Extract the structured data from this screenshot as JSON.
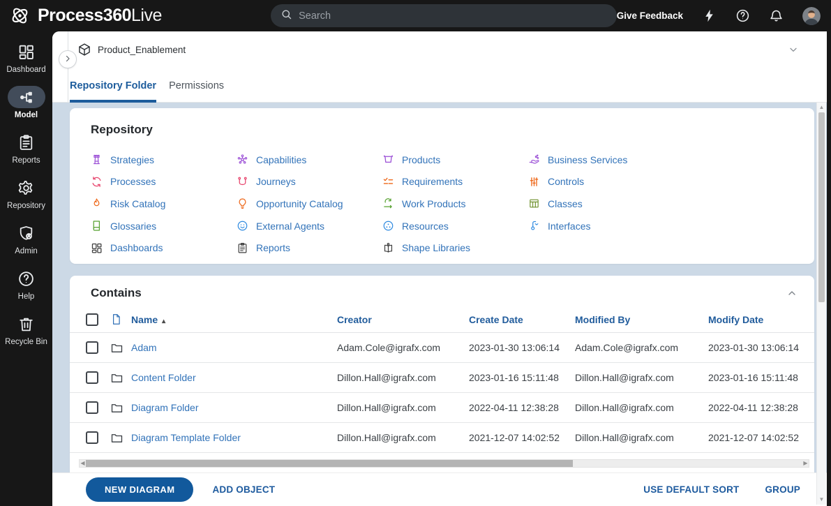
{
  "topbar": {
    "logo": {
      "bold": "Process360",
      "light": "Live",
      "icon": "logo"
    },
    "search": {
      "placeholder": "Search",
      "icon": "search"
    },
    "give_feedback": "Give Feedback",
    "actions": [
      {
        "icon": "lightning"
      },
      {
        "icon": "help-circle"
      },
      {
        "icon": "bell"
      }
    ],
    "avatar_icon": "avatar"
  },
  "sidebar": {
    "items": [
      {
        "label": "Dashboard",
        "icon": "dashboard",
        "active": false
      },
      {
        "label": "Model",
        "icon": "model",
        "active": true
      },
      {
        "label": "Reports",
        "icon": "reports",
        "active": false
      },
      {
        "label": "Repository",
        "icon": "repository",
        "active": false
      },
      {
        "label": "Admin",
        "icon": "admin",
        "active": false
      },
      {
        "label": "Help",
        "icon": "help",
        "active": false
      },
      {
        "label": "Recycle Bin",
        "icon": "recycle-bin",
        "active": false
      }
    ]
  },
  "page": {
    "title": "Product_Enablement",
    "title_icon": "cube",
    "tabs": [
      {
        "label": "Repository Folder",
        "active": true
      },
      {
        "label": "Permissions",
        "active": false
      }
    ]
  },
  "repository_panel": {
    "title": "Repository",
    "columns": [
      [
        {
          "label": "Strategies",
          "icon": "strategies",
          "color": "#9b4fd6"
        },
        {
          "label": "Processes",
          "icon": "processes",
          "color": "#e8476f"
        },
        {
          "label": "Risk Catalog",
          "icon": "risk-catalog",
          "color": "#ee6718"
        },
        {
          "label": "Glossaries",
          "icon": "glossaries",
          "color": "#55a02e"
        },
        {
          "label": "Dashboards",
          "icon": "dashboards",
          "color": "#3d3d3d"
        }
      ],
      [
        {
          "label": "Capabilities",
          "icon": "capabilities",
          "color": "#9b4fd6"
        },
        {
          "label": "Journeys",
          "icon": "journeys",
          "color": "#e8476f"
        },
        {
          "label": "Opportunity Catalog",
          "icon": "opportunity-catalog",
          "color": "#ee6718"
        },
        {
          "label": "External Agents",
          "icon": "external-agents",
          "color": "#2e8ae0"
        },
        {
          "label": "Reports",
          "icon": "reports",
          "color": "#3d3d3d"
        }
      ],
      [
        {
          "label": "Products",
          "icon": "products",
          "color": "#9b4fd6"
        },
        {
          "label": "Requirements",
          "icon": "requirements",
          "color": "#ee6718"
        },
        {
          "label": "Work Products",
          "icon": "work-products",
          "color": "#55a02e"
        },
        {
          "label": "Resources",
          "icon": "resources",
          "color": "#2e8ae0"
        },
        {
          "label": "Shape Libraries",
          "icon": "shape-libraries",
          "color": "#3d3d3d"
        }
      ],
      [
        {
          "label": "Business Services",
          "icon": "business-services",
          "color": "#9b4fd6"
        },
        {
          "label": "Controls",
          "icon": "controls",
          "color": "#ee6718"
        },
        {
          "label": "Classes",
          "icon": "classes",
          "color": "#6b8f28"
        },
        {
          "label": "Interfaces",
          "icon": "interfaces",
          "color": "#2e8ae0"
        }
      ]
    ]
  },
  "contains_panel": {
    "title": "Contains",
    "sort_column": "Name",
    "sort_direction": "asc",
    "columns": [
      "Name",
      "Creator",
      "Create Date",
      "Modified By",
      "Modify Date"
    ],
    "rows": [
      {
        "name": "Adam",
        "icon": "folder",
        "creator": "Adam.Cole@igrafx.com",
        "create_date": "2023-01-30 13:06:14",
        "modified_by": "Adam.Cole@igrafx.com",
        "modify_date": "2023-01-30 13:06:14"
      },
      {
        "name": "Content Folder",
        "icon": "folder",
        "creator": "Dillon.Hall@igrafx.com",
        "create_date": "2023-01-16 15:11:48",
        "modified_by": "Dillon.Hall@igrafx.com",
        "modify_date": "2023-01-16 15:11:48"
      },
      {
        "name": "Diagram Folder",
        "icon": "folder",
        "creator": "Dillon.Hall@igrafx.com",
        "create_date": "2022-04-11 12:38:28",
        "modified_by": "Dillon.Hall@igrafx.com",
        "modify_date": "2022-04-11 12:38:28"
      },
      {
        "name": "Diagram Template Folder",
        "icon": "folder",
        "creator": "Dillon.Hall@igrafx.com",
        "create_date": "2021-12-07 14:02:52",
        "modified_by": "Dillon.Hall@igrafx.com",
        "modify_date": "2021-12-07 14:02:52"
      }
    ]
  },
  "footer": {
    "new_diagram": "NEW DIAGRAM",
    "add_object": "ADD OBJECT",
    "use_default_sort": "USE DEFAULT SORT",
    "group": "GROUP"
  },
  "colors": {
    "topbar_bg": "#171717",
    "content_bg": "#ccd9e6",
    "accent_blue": "#1d5c9c",
    "link_blue": "#3273b9",
    "primary_button": "#12599c",
    "active_pill": "#424c5a"
  }
}
